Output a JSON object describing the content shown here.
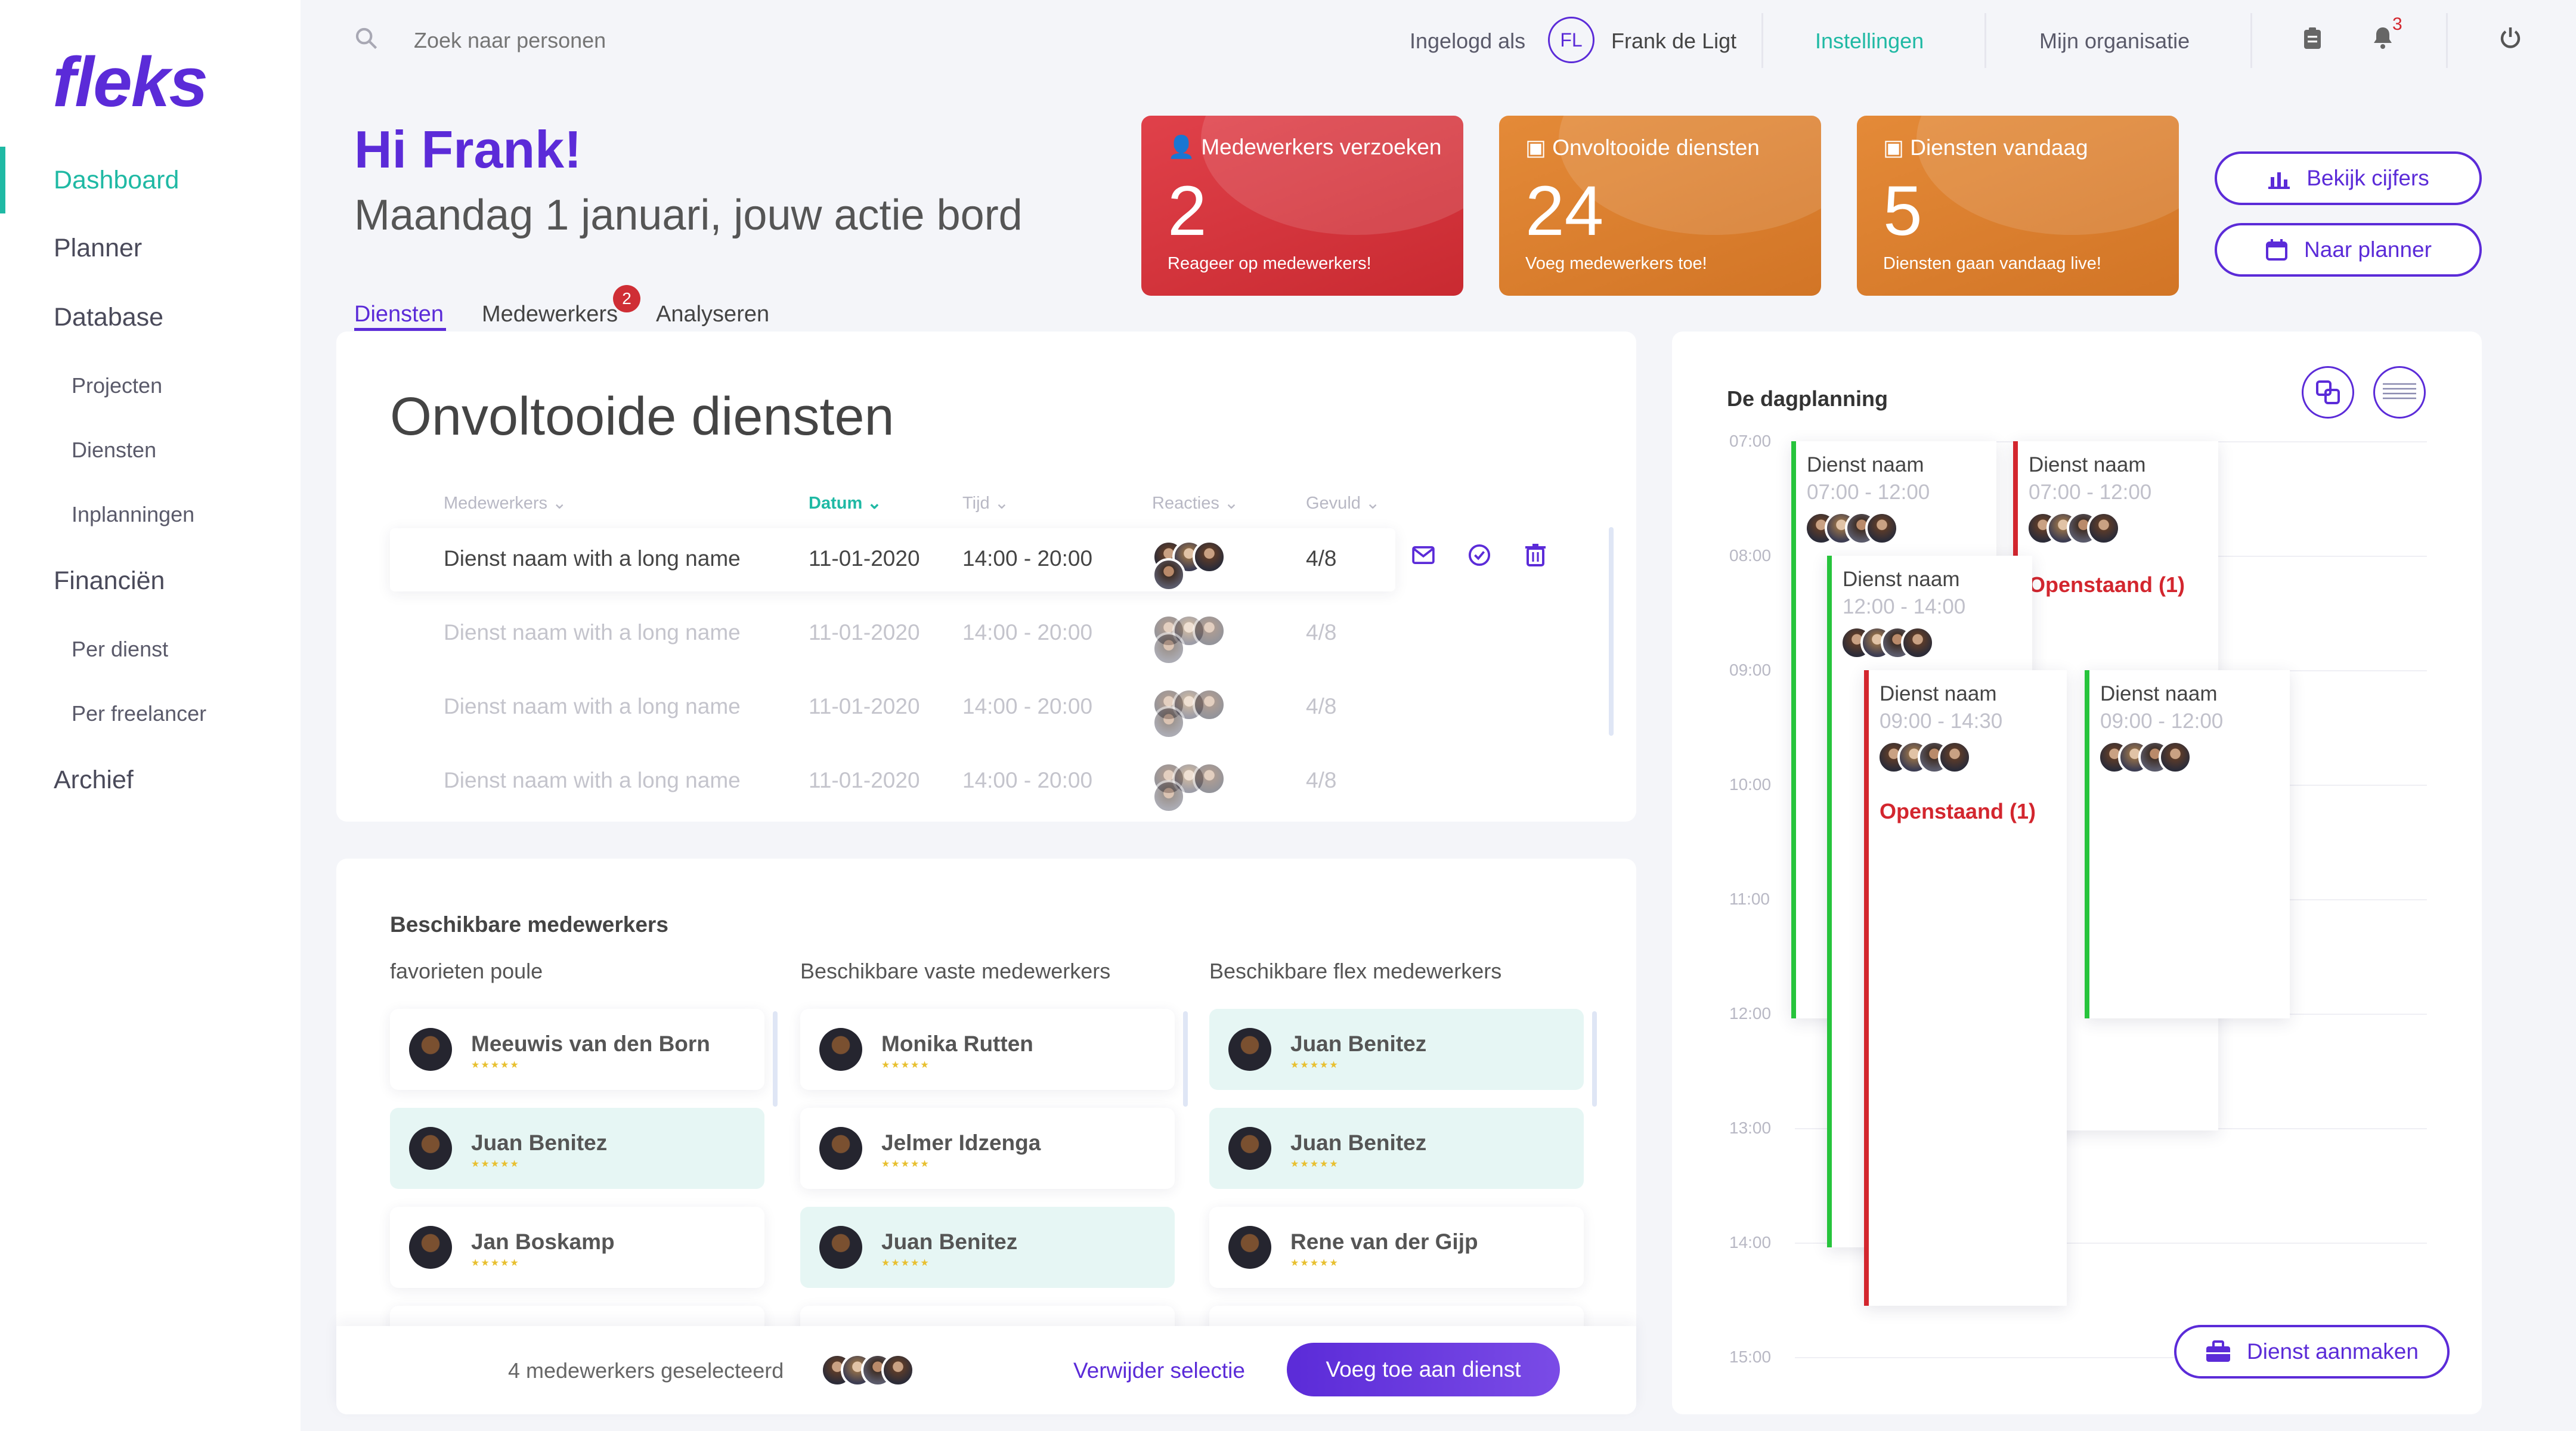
{
  "brand": {
    "logo": "fleks"
  },
  "sidebar": {
    "items": [
      "Dashboard",
      "Planner",
      "Database",
      "Projecten",
      "Diensten",
      "Inplanningen",
      "Financiën",
      "Per dienst",
      "Per freelancer",
      "Archief"
    ]
  },
  "topbar": {
    "search_placeholder": "Zoek naar personen",
    "logged_in_label": "Ingelogd als",
    "user_initials": "FL",
    "user_name": "Frank de Ligt",
    "settings": "Instellingen",
    "organisation": "Mijn organisatie",
    "notification_count": "3"
  },
  "header": {
    "greeting": "Hi Frank!",
    "subtitle": "Maandag 1 januari, jouw actie bord"
  },
  "stats": [
    {
      "title": "Medewerkers verzoeken",
      "value": "2",
      "desc": "Reageer op medewerkers!",
      "color": "#cf2e35"
    },
    {
      "title": "Onvoltooide diensten",
      "value": "24",
      "desc": "Voeg medewerkers toe!",
      "color": "#d97b2a"
    },
    {
      "title": "Diensten vandaag",
      "value": "5",
      "desc": "Diensten gaan vandaag live!",
      "color": "#d97b2a"
    }
  ],
  "actions": {
    "figures": "Bekijk cijfers",
    "planner": "Naar planner"
  },
  "tabs": {
    "items": [
      "Diensten",
      "Medewerkers",
      "Analyseren"
    ],
    "badge": "2"
  },
  "shifts_card": {
    "title": "Onvoltooide diensten",
    "headers": [
      "Medewerkers",
      "Datum",
      "Tijd",
      "Reacties",
      "Gevuld"
    ],
    "rows": [
      {
        "name": "Dienst naam with a long name",
        "date": "11-01-2020",
        "time": "14:00 - 20:00",
        "filled": "4/8"
      },
      {
        "name": "Dienst naam with a long name",
        "date": "11-01-2020",
        "time": "14:00 - 20:00",
        "filled": "4/8"
      },
      {
        "name": "Dienst naam with a long name",
        "date": "11-01-2020",
        "time": "14:00 - 20:00",
        "filled": "4/8"
      },
      {
        "name": "Dienst naam with a long name",
        "date": "11-01-2020",
        "time": "14:00 - 20:00",
        "filled": "4/8"
      }
    ]
  },
  "employees": {
    "title": "Beschikbare medewerkers",
    "columns": [
      {
        "title": "favorieten poule",
        "people": [
          "Meeuwis van den Born",
          "Juan Benitez",
          "Jan Boskamp"
        ]
      },
      {
        "title": "Beschikbare vaste medewerkers",
        "people": [
          "Monika Rutten",
          "Jelmer Idzenga",
          "Juan Benitez"
        ]
      },
      {
        "title": "Beschikbare flex medewerkers",
        "people": [
          "Juan Benitez",
          "Juan Benitez",
          "Rene van der Gijp"
        ]
      }
    ],
    "rating": "★★★★★",
    "selected_text": "4 medewerkers geselecteerd",
    "remove": "Verwijder selectie",
    "add": "Voeg toe aan dienst"
  },
  "schedule": {
    "title": "De dagplanning",
    "hours": [
      "07:00",
      "08:00",
      "09:00",
      "10:00",
      "11:00",
      "12:00",
      "13:00",
      "14:00",
      "15:00"
    ],
    "shifts": [
      {
        "name": "Dienst naam",
        "time": "07:00 - 12:00",
        "status": ""
      },
      {
        "name": "Dienst naam",
        "time": "07:00 - 12:00",
        "status": "Openstaand (1)"
      },
      {
        "name": "Dienst naam",
        "time": "12:00 - 14:00",
        "status": ""
      },
      {
        "name": "Dienst naam",
        "time": "09:00 - 14:30",
        "status": "Openstaand (1)"
      },
      {
        "name": "Dienst naam",
        "time": "09:00 - 12:00",
        "status": ""
      }
    ],
    "create": "Dienst aanmaken"
  }
}
